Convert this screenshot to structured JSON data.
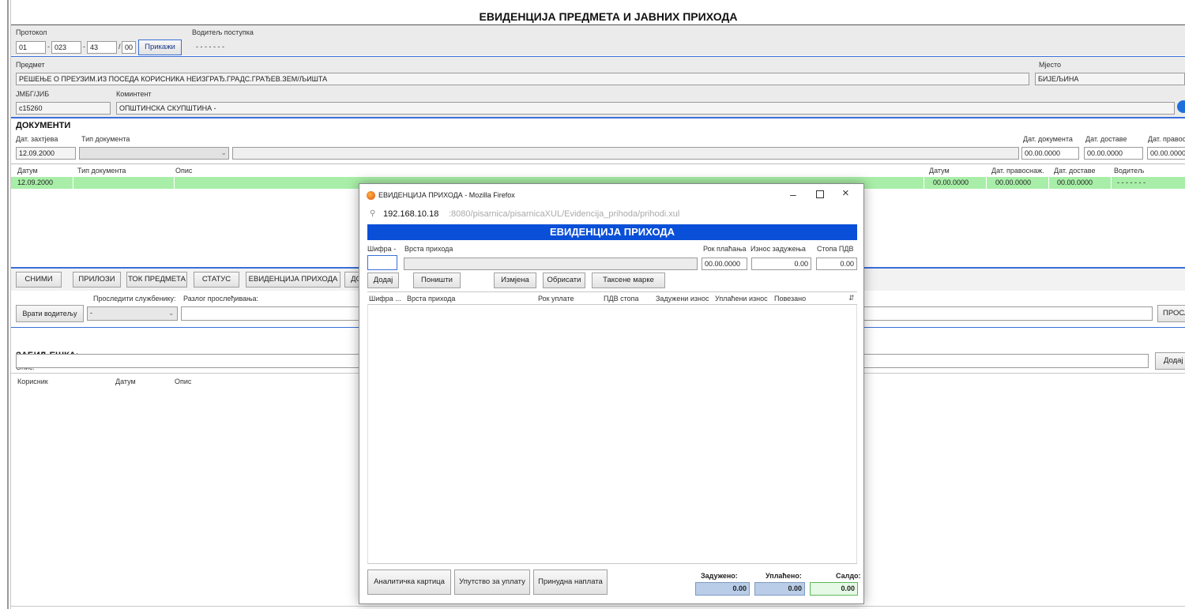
{
  "header": {
    "title": "ЕВИДЕНЦИЈА ПРЕДМЕТА И ЈАВНИХ ПРИХОДА"
  },
  "protocol": {
    "label": "Протокол",
    "parts": [
      "01",
      "023",
      "43",
      "00"
    ],
    "separators": [
      "-",
      "-",
      "/"
    ],
    "show_button": "Прикажи",
    "leader_label": "Водитељ поступка",
    "leader_value": "- - - - - - -"
  },
  "subject": {
    "label": "Предмет",
    "value": "РЕШЕЊЕ О ПРЕУЗИМ.ИЗ ПОСЕДА КОРИСНИКА НЕИЗГРАЂ.ГРАДС.ГРАЂЕВ.ЗЕМ/ЉИШТА",
    "place_label": "Мјесто",
    "place_value": "БИЈЕЉИНА"
  },
  "client": {
    "id_label": "ЈМБГ/ЈИБ",
    "id_value": "c15260",
    "name_label": "Коминтент",
    "name_value": "ОПШТИНСКА СКУПШТИНА -"
  },
  "documents": {
    "title": "ДОКУМЕНТИ",
    "request_date_label": "Дат. захтјева",
    "request_date": "12.09.2000",
    "doc_type_label": "Тип документа",
    "doc_date_label": "Дат. документа",
    "doc_date": "00.00.0000",
    "delivery_label": "Дат. доставе",
    "delivery_date": "00.00.0000",
    "final_label": "Дат. правосн",
    "final_date": "00.00.0000",
    "columns": [
      "Датум",
      "Тип документа",
      "Опис",
      "Датум",
      "Дат. правоснаж.",
      "Дат. доставе",
      "Водитељ"
    ],
    "rows": [
      {
        "date": "12.09.2000",
        "type": "",
        "desc": "",
        "date2": "00.00.0000",
        "final": "00.00.0000",
        "delivery": "00.00.0000",
        "leader": "- - - - - - -"
      }
    ]
  },
  "actions": {
    "buttons": [
      "СНИМИ",
      "ПРИЛОЗИ",
      "ТОК ПРЕДМЕТА",
      "СТАТУС",
      "ЕВИДЕНЦИЈА ПРИХОДА",
      "ДО"
    ],
    "forward_label": "Проследити службенику:",
    "reason_label": "Разлог прослеђивања:",
    "return_button": "Врати водитељу",
    "forward_select": "-",
    "forward_button": "ПРОСЛЕЂ"
  },
  "notes": {
    "title": "ЗАБИЉЕШКА:",
    "desc_label": "Опис:",
    "add_button": "Додај",
    "columns": [
      "Корисник",
      "Датум",
      "Опис"
    ]
  },
  "popup": {
    "window_title": "ЕВИДЕНЦИЈА ПРИХОДА - Mozilla Firefox",
    "url_host": "192.168.10.18",
    "url_rest": ":8080/pisarnica/pisarnicaXUL/Evidencija_prihoda/prihodi.xul",
    "header": "ЕВИДЕНЦИЈА ПРИХОДА",
    "code_label": "Шифра -",
    "type_label": "Врста прихода",
    "due_label": "Рок плаћања",
    "amount_label": "Износ задужења",
    "vat_label": "Стопа ПДВ",
    "due_value": "00.00.0000",
    "amount_value": "0.00",
    "vat_value": "0.00",
    "buttons": [
      "Додај",
      "Поништи",
      "Измјена",
      "Обрисати",
      "Таксене марке"
    ],
    "columns": [
      "Шифра ...",
      "Врста прихода",
      "Рок уплате",
      "ПДВ стопа",
      "Задужени износ",
      "Уплаћени износ",
      "Повезано"
    ],
    "bottom_buttons": [
      "Аналитичка картица",
      "Упутство за уплату",
      "Принудна наплата"
    ],
    "totals": {
      "charged_label": "Задужено:",
      "paid_label": "Уплаћено:",
      "balance_label": "Салдо:",
      "charged": "0.00",
      "paid": "0.00",
      "balance": "0.00"
    },
    "colors": {
      "header_bg": "#0a4fd8",
      "row_highlight": "#a8eea8"
    }
  }
}
